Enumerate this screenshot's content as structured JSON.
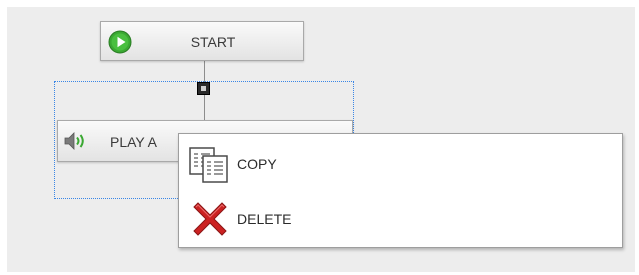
{
  "flow": {
    "start_node": {
      "label": "START",
      "icon": "play-circle-icon"
    },
    "play_node": {
      "label": "PLAY A",
      "icon": "speaker-icon"
    }
  },
  "context_menu": {
    "items": [
      {
        "label": "COPY",
        "icon": "copy-icon"
      },
      {
        "label": "DELETE",
        "icon": "delete-x-icon"
      }
    ]
  },
  "colors": {
    "canvas": "#ededed",
    "selection": "#3a86e6",
    "start_icon": "#3aa832",
    "delete_icon": "#cc2222"
  }
}
